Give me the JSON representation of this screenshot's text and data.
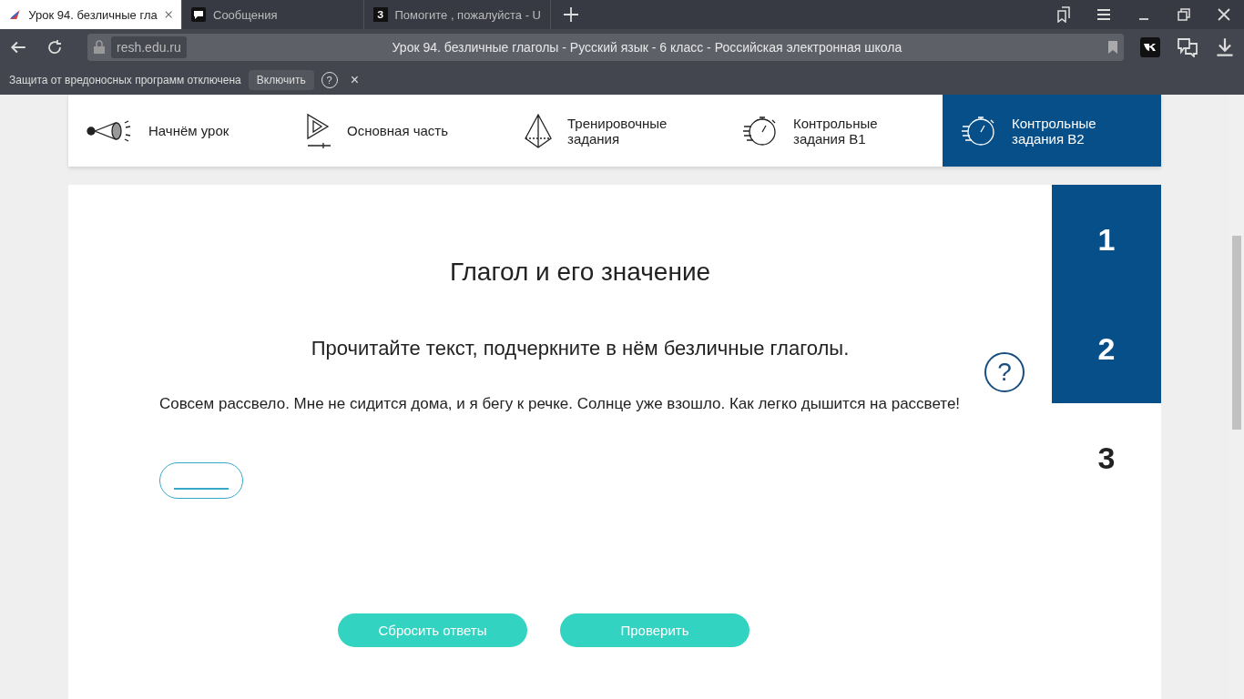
{
  "browser": {
    "tabs": [
      {
        "title": "Урок 94. безличные гла",
        "selected": true
      },
      {
        "title": "Сообщения",
        "selected": false
      },
      {
        "title": "Помогите , пожалуйста - U",
        "selected": false,
        "glyph": "З"
      }
    ],
    "address": {
      "domain": "resh.edu.ru",
      "title": "Урок 94. безличные глаголы - Русский язык - 6 класс - Российская электронная школа"
    },
    "notice": {
      "text": "Защита от вредоносных программ отключена",
      "button": "Включить",
      "help": "?",
      "close": "×"
    }
  },
  "lesson_nav": [
    {
      "label": "Начнём урок",
      "selected": false
    },
    {
      "label": "Основная часть",
      "selected": false
    },
    {
      "label": "Тренировочные задания",
      "selected": false
    },
    {
      "label": "Контрольные задания В1",
      "selected": false
    },
    {
      "label": "Контрольные задания В2",
      "selected": true
    }
  ],
  "task": {
    "title": "Глагол и его значение",
    "instruction": "Прочитайте текст, подчеркните в нём безличные глаголы.",
    "help": "?",
    "text": "Совсем рассвело. Мне не сидится дома, и я бегу к речке. Солнце уже взошло. Как легко дышится на рассвете!",
    "buttons": [
      "Сбросить ответы",
      "Проверить"
    ]
  },
  "steps": [
    {
      "label": "1",
      "done": true
    },
    {
      "label": "2",
      "done": true
    },
    {
      "label": "3",
      "done": false
    }
  ]
}
